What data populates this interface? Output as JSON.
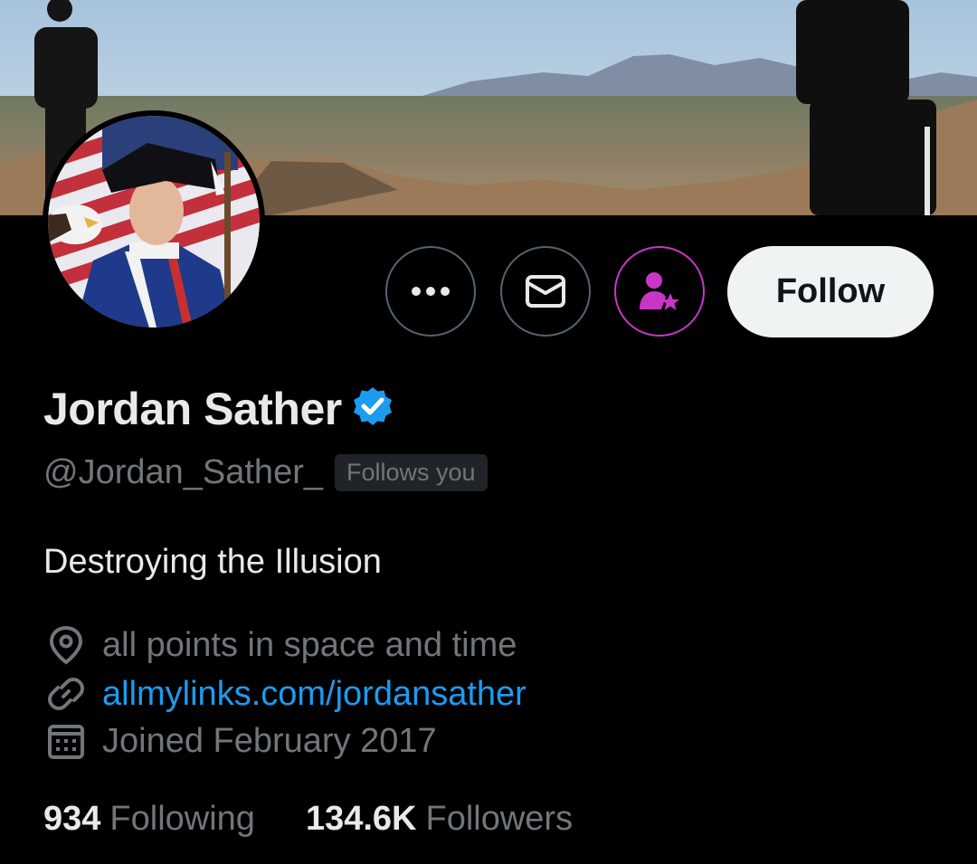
{
  "profile": {
    "name": "Jordan Sather",
    "handle": "@Jordan_Sather_",
    "follows_you": "Follows you",
    "bio": "Destroying the Illusion",
    "location": "all points in space and time",
    "website": "allmylinks.com/jordansather",
    "joined": "Joined February 2017",
    "verified": true
  },
  "actions": {
    "more_icon": "more-icon",
    "message_icon": "envelope-icon",
    "subscribe_icon": "subscribe-person-star-icon",
    "follow_label": "Follow"
  },
  "stats": {
    "following_count": "934",
    "following_label": "Following",
    "followers_count": "134.6K",
    "followers_label": "Followers"
  },
  "colors": {
    "background": "#000000",
    "link": "#1d9bf0",
    "verified": "#1d9bf0",
    "subscribe_accent": "#c936c7",
    "muted_text": "#71767b"
  }
}
